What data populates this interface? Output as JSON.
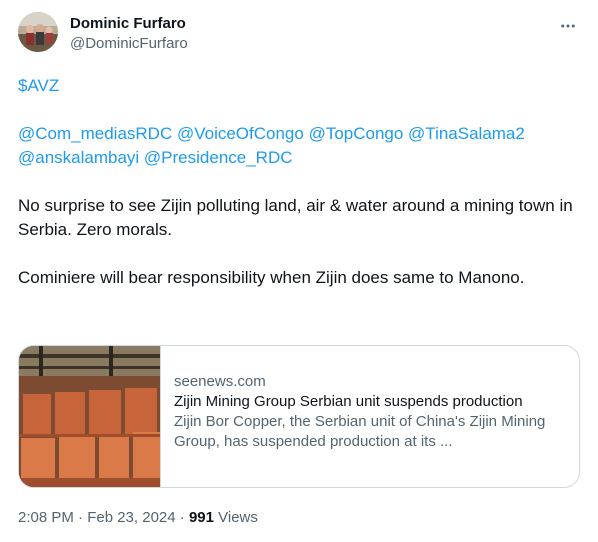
{
  "author": {
    "display_name": "Dominic Furfaro",
    "handle": "@DominicFurfaro",
    "avatar_icon": "profile-photo"
  },
  "more_icon": "more-horizontal-icon",
  "tweet": {
    "cashtag": "$AVZ",
    "mentions_line1": "@Com_mediasRDC @VoiceOfCongo @TopCongo @TinaSalama2",
    "mentions_line2": "@anskalambayi @Presidence_RDC",
    "paragraph1": "No surprise to see Zijin polluting land, air & water around a mining town in Serbia. Zero morals.",
    "paragraph2": "Cominiere will bear responsibility when Zijin does same to Manono."
  },
  "card": {
    "domain": "seenews.com",
    "title": "Zijin Mining Group Serbian unit suspends production",
    "description": "Zijin Bor Copper, the Serbian unit of China's Zijin Mining Group, has suspended production at its ...",
    "image_icon": "copper-cathodes-photo"
  },
  "meta": {
    "timestamp": "2:08 PM · Feb 23, 2024 · ",
    "views_count": "991",
    "views_label": " Views"
  },
  "colors": {
    "link": "#1d9bf0",
    "text": "#0f1419",
    "secondary": "#536471",
    "border": "#cfd9de"
  }
}
